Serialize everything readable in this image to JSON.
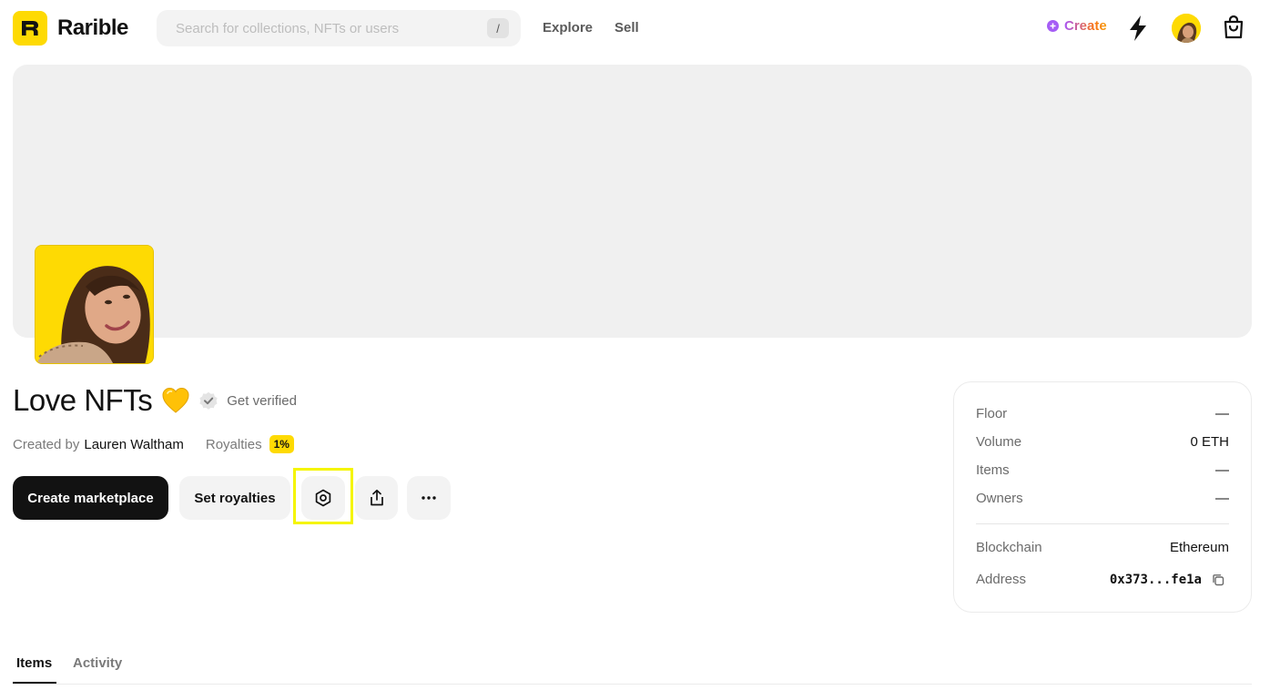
{
  "header": {
    "logo_text": "Rarible",
    "search_placeholder": "Search for collections, NFTs or users",
    "search_shortcut": "/",
    "nav": {
      "explore": "Explore",
      "sell": "Sell"
    },
    "create_label": "Create"
  },
  "collection": {
    "title": "Love NFTs",
    "verify_label": "Get verified",
    "created_by_label": "Created by",
    "creator": "Lauren Waltham",
    "royalties_label": "Royalties",
    "royalties_value": "1%"
  },
  "actions": {
    "create_marketplace": "Create marketplace",
    "set_royalties": "Set royalties"
  },
  "stats": {
    "floor_label": "Floor",
    "floor_value": "—",
    "volume_label": "Volume",
    "volume_value": "0 ETH",
    "items_label": "Items",
    "items_value": "—",
    "owners_label": "Owners",
    "owners_value": "—",
    "blockchain_label": "Blockchain",
    "blockchain_value": "Ethereum",
    "address_label": "Address",
    "address_value": "0x373...fe1a"
  },
  "tabs": {
    "items": "Items",
    "activity": "Activity"
  },
  "colors": {
    "brand_yellow": "#FEDA03",
    "dark": "#121212",
    "highlight": "#F5F500"
  }
}
